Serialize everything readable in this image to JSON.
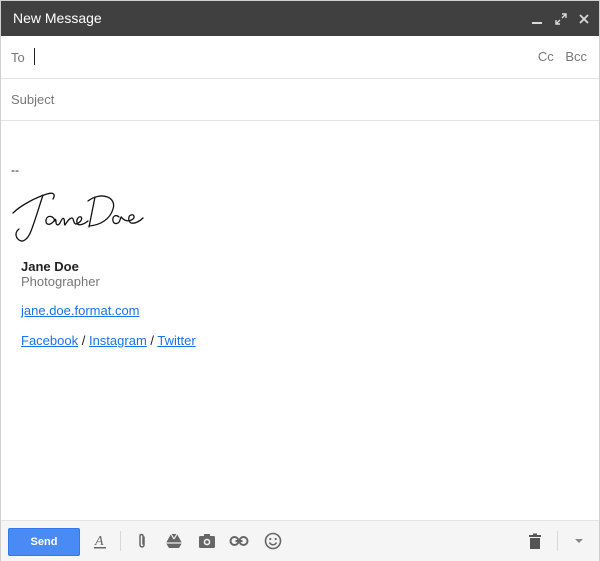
{
  "window": {
    "title": "New Message",
    "minimize_icon": "minimize-icon",
    "expand_icon": "expand-icon",
    "close_icon": "close-icon"
  },
  "to": {
    "label": "To",
    "cc": "Cc",
    "bcc": "Bcc"
  },
  "subject": {
    "label": "Subject"
  },
  "body": {
    "dashes": "--",
    "signature_image": "handwritten signature 'Jane Doe'",
    "name": "Jane Doe",
    "title": "Photographer",
    "website": "jane.doe.format.com",
    "social": [
      {
        "label": "Facebook"
      },
      {
        "label": "Instagram"
      },
      {
        "label": "Twitter"
      }
    ],
    "separator": "/"
  },
  "toolbar": {
    "send_label": "Send",
    "icons": [
      "formatting-icon",
      "attach-icon",
      "drive-icon",
      "photo-icon",
      "link-icon",
      "emoji-icon",
      "trash-icon",
      "more-options-icon"
    ]
  },
  "colors": {
    "titlebar": "#404040",
    "send": "#4a8af4",
    "link": "#1a73e8"
  }
}
